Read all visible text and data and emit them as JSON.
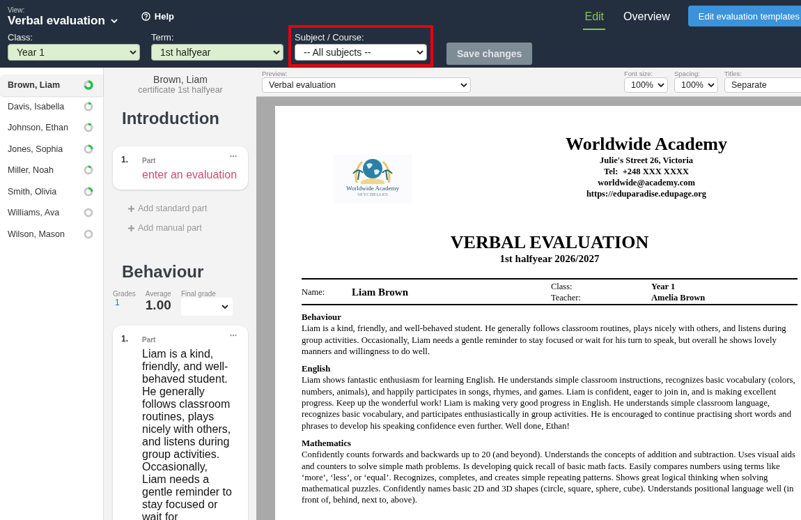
{
  "view": {
    "label": "View:",
    "title": "Verbal evaluation"
  },
  "help": "Help",
  "tabs": [
    {
      "label": "Edit",
      "selected": true
    },
    {
      "label": "Overview",
      "selected": false
    }
  ],
  "templates_button": "Edit evaluation templates",
  "filters": [
    {
      "label": "Class:",
      "value": "Year 1",
      "set": true,
      "highlighted": false
    },
    {
      "label": "Term:",
      "value": "1st halfyear",
      "set": true,
      "highlighted": false
    },
    {
      "label": "Subject / Course:",
      "value": "-- All subjects --",
      "set": false,
      "highlighted": true
    }
  ],
  "save_button": {
    "label": "Save changes",
    "disabled": true
  },
  "students": [
    {
      "name": "Brown, Liam",
      "kind": "mostly",
      "selected": true
    },
    {
      "name": "Davis, Isabella",
      "kind": "started",
      "selected": false
    },
    {
      "name": "Johnson, Ethan",
      "kind": "started",
      "selected": false
    },
    {
      "name": "Jones, Sophia",
      "kind": "quarter",
      "selected": false
    },
    {
      "name": "Miller, Noah",
      "kind": "started",
      "selected": false
    },
    {
      "name": "Smith, Olivia",
      "kind": "quarter",
      "selected": false
    },
    {
      "name": "Williams, Ava",
      "kind": "empty",
      "selected": false
    },
    {
      "name": "Wilson, Mason",
      "kind": "empty",
      "selected": false
    }
  ],
  "editor": {
    "student": "Brown, Liam",
    "certificate": "certificate 1st halfyear",
    "sections": [
      {
        "title": "Introduction",
        "parts": [
          {
            "number": "1.",
            "label": "Part",
            "text": "enter an evaluation",
            "kind": "placeholder"
          }
        ],
        "actions": [
          "Add standard part",
          "Add manual part"
        ]
      },
      {
        "title": "Behaviour",
        "stats": {
          "grades_label": "Grades",
          "grades": "1",
          "average_label": "Average",
          "average": "1.00",
          "final_label": "Final grade"
        },
        "parts": [
          {
            "number": "1.",
            "label": "Part",
            "text": "Liam is a kind, friendly, and well-behaved student. He generally follows classroom routines, plays nicely with others, and listens during group activities. Occasionally, Liam needs a gentle reminder to stay focused or wait for",
            "kind": "text"
          }
        ]
      }
    ]
  },
  "preview_bar": {
    "preview": {
      "label": "Preview:",
      "value": "Verbal evaluation"
    },
    "font_size": {
      "label": "Font size:",
      "value": "100%"
    },
    "spacing": {
      "label": "Spacing:",
      "value": "100%"
    },
    "titles": {
      "label": "Titles:",
      "value": "Separate"
    }
  },
  "document": {
    "logo_text": "Worldwide Academy",
    "logo_subtext": "SEYCHELLES",
    "school": "Worldwide Academy",
    "school_lines": [
      "Julie's Street 26, Victoria",
      "Tel:  +248 XXX XXXX",
      "worldwide@academy.com",
      "https://eduparadise.edupage.org"
    ],
    "title": "VERBAL EVALUATION",
    "subtitle": "1st halfyear 2026/2027",
    "info": {
      "name_label": "Name:",
      "name": "Liam Brown",
      "class_label": "Class:",
      "class": "Year 1",
      "teacher_label": "Teacher:",
      "teacher": "Amelia Brown"
    },
    "sections": [
      {
        "heading": "Behaviour",
        "text": "Liam is a kind, friendly, and well-behaved student. He generally follows classroom routines, plays nicely with others, and listens during group activities. Occasionally, Liam needs a gentle reminder to stay focused or wait for his turn to speak, but overall he shows lovely manners and willingness to do well."
      },
      {
        "heading": "English",
        "text": "Liam shows fantastic enthusiasm for learning English. He understands simple classroom instructions, recognizes basic vocabulary (colors, numbers, animals), and happily participates in songs, rhymes, and games. Liam is confident, eager to join in, and is making excellent progress. Keep up the wonderful work! Liam is making very good progress in English. He understands simple classroom language, recognizes basic vocabulary, and participates enthusiastically in group activities. He is encouraged to continue practising short words and phrases to develop his speaking confidence even further. Well done, Ethan!"
      },
      {
        "heading": "Mathematics",
        "text": "Confidently counts forwards and backwards up to 20 (and beyond). Understands the concepts of addition and subtraction. Uses visual aids and counters to solve simple math problems. Is developing quick recall of basic math facts. Easily compares numbers using terms like ‘more’, ‘less’, or ‘equal’. Recognizes, completes, and creates simple repeating patterns. Shows great logical thinking when solving mathematical puzzles. Confidently names basic 2D and 3D shapes (circle, square, sphere, cube). Understands positional language well (in front of, behind, next to, above)."
      }
    ]
  }
}
